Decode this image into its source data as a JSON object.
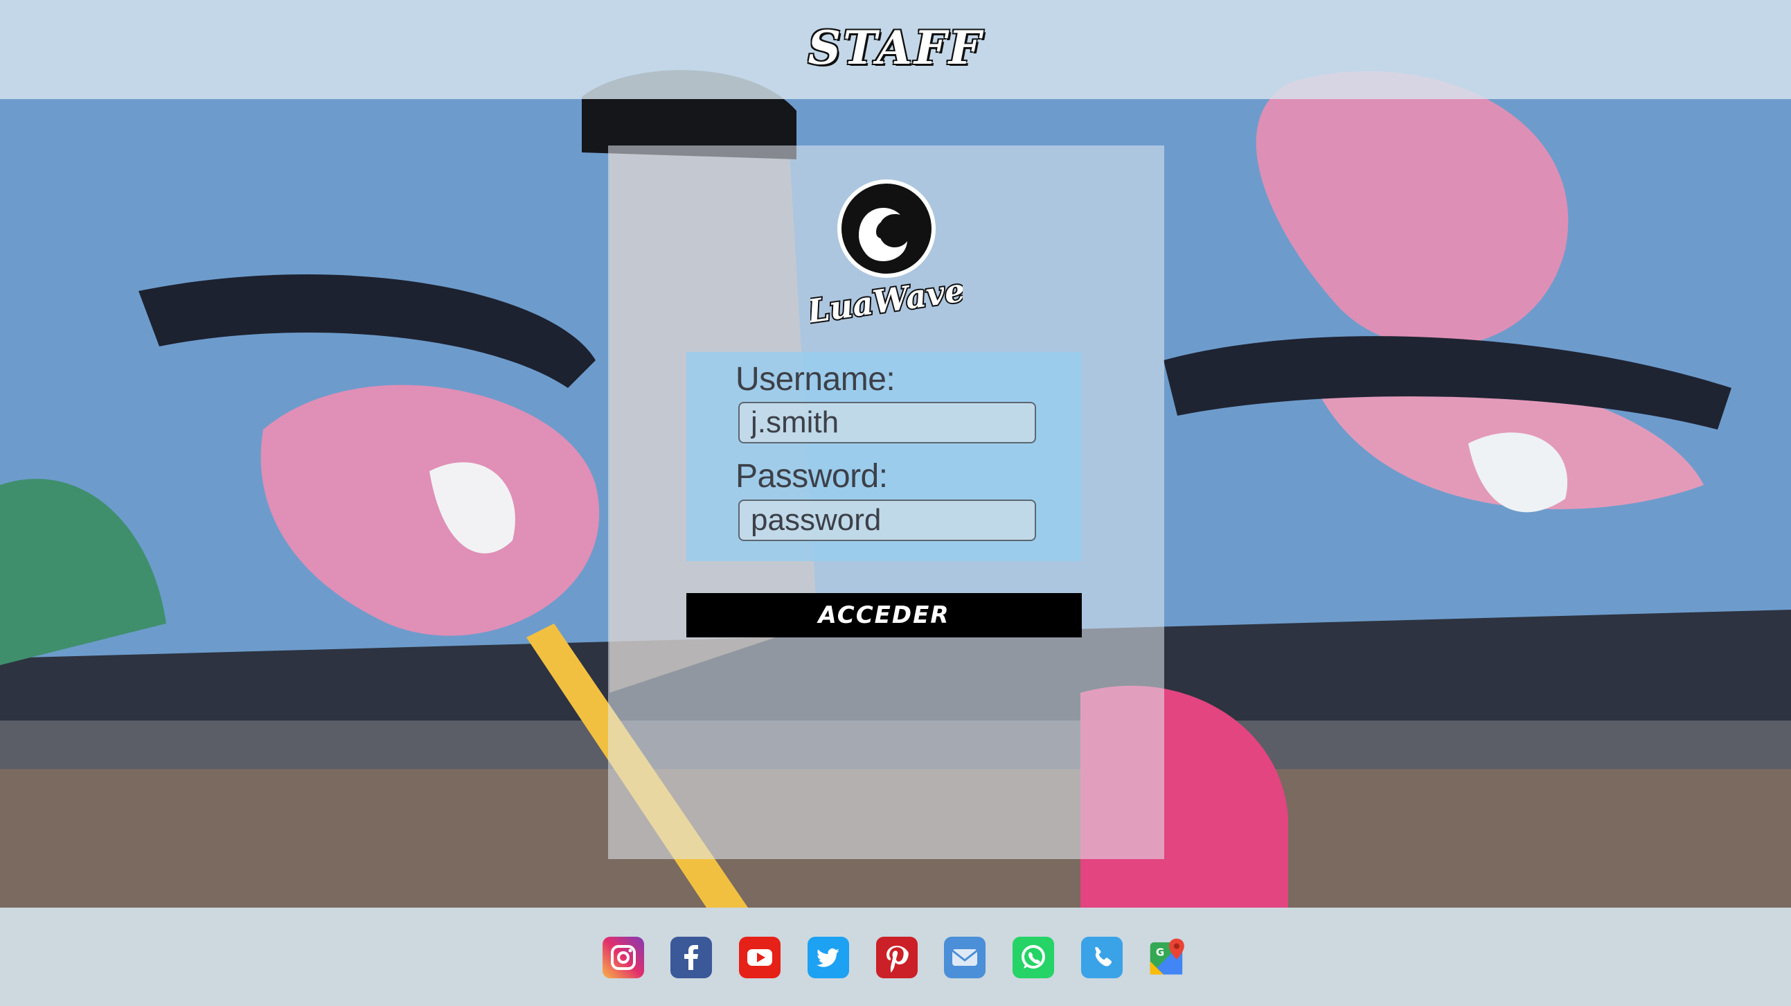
{
  "header": {
    "title": "STAFF"
  },
  "brand": {
    "logo_text": "LuaWave"
  },
  "login": {
    "username_label": "Username:",
    "username_placeholder": "j.smith",
    "password_label": "Password:",
    "password_placeholder": "password",
    "submit_label": "ACCEDER"
  },
  "social": [
    {
      "icon": "instagram-icon",
      "color": "#c13584"
    },
    {
      "icon": "facebook-icon",
      "color": "#3b5998"
    },
    {
      "icon": "youtube-icon",
      "color": "#e62117"
    },
    {
      "icon": "twitter-icon",
      "color": "#1da1f2"
    },
    {
      "icon": "pinterest-icon",
      "color": "#cb2027"
    },
    {
      "icon": "email-icon",
      "color": "#4a8fd8"
    },
    {
      "icon": "whatsapp-icon",
      "color": "#25d366"
    },
    {
      "icon": "phone-icon",
      "color": "#3aa3e8"
    },
    {
      "icon": "google-maps-icon",
      "color": "#34a853"
    }
  ]
}
